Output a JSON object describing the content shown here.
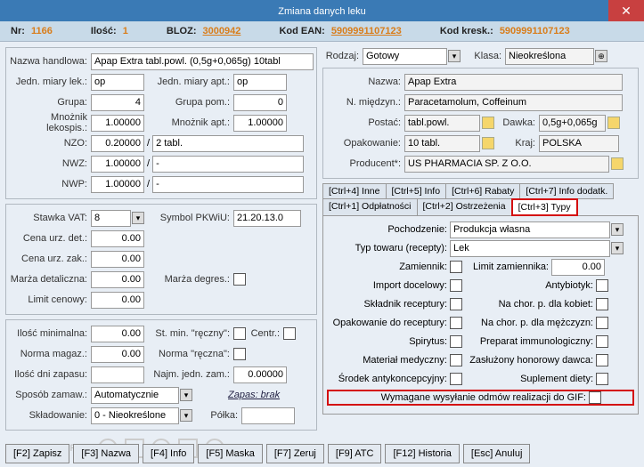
{
  "title": "Zmiana danych leku",
  "header": {
    "nr_lbl": "Nr:",
    "nr": "1166",
    "ilosc_lbl": "Ilość:",
    "ilosc": "1",
    "bloz_lbl": "BLOZ:",
    "bloz": "3000942",
    "ean_lbl": "Kod EAN:",
    "ean": "5909991107123",
    "kresk_lbl": "Kod kresk.:",
    "kresk": "5909991107123"
  },
  "left": {
    "nazwa_h_lbl": "Nazwa handlowa:",
    "nazwa_h": "Apap Extra tabl.powl. (0,5g+0,065g) 10tabl",
    "jedn_lek_lbl": "Jedn. miary lek.:",
    "jedn_lek": "op",
    "jedn_apt_lbl": "Jedn. miary apt.:",
    "jedn_apt": "op",
    "grupa_lbl": "Grupa:",
    "grupa": "4",
    "grupa_pom_lbl": "Grupa pom.:",
    "grupa_pom": "0",
    "mnoz_lek_lbl": "Mnożnik lekospis.:",
    "mnoz_lek": "1.00000",
    "mnoz_apt_lbl": "Mnożnik apt.:",
    "mnoz_apt": "1.00000",
    "nzo_lbl": "NZO:",
    "nzo": "0.20000",
    "nzo2": "2 tabl.",
    "nwz_lbl": "NWZ:",
    "nwz": "1.00000",
    "nwz2": "-",
    "nwp_lbl": "NWP:",
    "nwp": "1.00000",
    "nwp2": "-",
    "vat_lbl": "Stawka VAT:",
    "vat": "8",
    "pkwiu_lbl": "Symbol PKWiU:",
    "pkwiu": "21.20.13.0",
    "cena_det_lbl": "Cena urz. det.:",
    "cena_det": "0.00",
    "cena_zak_lbl": "Cena urz. zak.:",
    "cena_zak": "0.00",
    "marza_d_lbl": "Marża detaliczna:",
    "marza_d": "0.00",
    "marza_deg_lbl": "Marża degres.:",
    "limit_lbl": "Limit cenowy:",
    "limit": "0.00",
    "ilosc_min_lbl": "Ilość minimalna:",
    "ilosc_min": "0.00",
    "st_min_lbl": "St. min. \"ręczny\":",
    "centr_lbl": "Centr.:",
    "norma_mag_lbl": "Norma magaz.:",
    "norma_mag": "0.00",
    "norma_r_lbl": "Norma \"ręczna\":",
    "ilosc_dni_lbl": "Ilość dni zapasu:",
    "ilosc_dni": "",
    "najm_lbl": "Najm. jedn. zam.:",
    "najm": "0.00000",
    "sposob_lbl": "Sposób zamaw.:",
    "sposob": "Automatycznie",
    "zapas_lbl": "Zapas: brak",
    "sklad_lbl": "Składowanie:",
    "sklad": "0 - Nieokreślone",
    "polka_lbl": "Półka:"
  },
  "right": {
    "rodzaj_lbl": "Rodzaj:",
    "rodzaj": "Gotowy",
    "klasa_lbl": "Klasa:",
    "klasa": "Nieokreślona",
    "nazwa_lbl": "Nazwa:",
    "nazwa": "Apap Extra",
    "miedzyn_lbl": "N. międzyn.:",
    "miedzyn": "Paracetamolum, Coffeinum",
    "postac_lbl": "Postać:",
    "postac": "tabl.powl.",
    "dawka_lbl": "Dawka:",
    "dawka": "0,5g+0,065g",
    "opak_lbl": "Opakowanie:",
    "opak": "10 tabl.",
    "kraj_lbl": "Kraj:",
    "kraj": "POLSKA",
    "prod_lbl": "Producent*:",
    "prod": "US PHARMACIA SP. Z O.O."
  },
  "tabs": {
    "t4": "[Ctrl+4] Inne",
    "t5": "[Ctrl+5] Info",
    "t6": "[Ctrl+6] Rabaty",
    "t7": "[Ctrl+7] Info dodatk.",
    "t1": "[Ctrl+1] Odpłatności",
    "t2": "[Ctrl+2] Ostrzeżenia",
    "t3": "[Ctrl+3] Typy"
  },
  "types": {
    "poch_lbl": "Pochodzenie:",
    "poch": "Produkcja własna",
    "typ_lbl": "Typ towaru (recepty):",
    "typ": "Lek",
    "zam_lbl": "Zamiennik:",
    "limzam_lbl": "Limit zamiennika:",
    "limzam": "0.00",
    "imp_lbl": "Import docelowy:",
    "anty_lbl": "Antybiotyk:",
    "sklr_lbl": "Składnik receptury:",
    "kob_lbl": "Na chor. p. dla kobiet:",
    "opakr_lbl": "Opakowanie do receptury:",
    "mez_lbl": "Na chor. p. dla mężczyzn:",
    "spir_lbl": "Spirytus:",
    "immun_lbl": "Preparat immunologiczny:",
    "mat_lbl": "Materiał medyczny:",
    "zasl_lbl": "Zasłużony honorowy dawca:",
    "srod_lbl": "Środek antykoncepcyjny:",
    "supl_lbl": "Suplement diety:",
    "gif_lbl": "Wymagane wysyłanie odmów realizacji do GIF:"
  },
  "footer": {
    "f2": "[F2] Zapisz",
    "f3": "[F3] Nazwa",
    "f4": "[F4] Info",
    "f5": "[F5] Maska",
    "f7": "[F7] Zeruj",
    "f9": "[F9] ATC",
    "f12": "[F12] Historia",
    "esc": "[Esc] Anuluj"
  }
}
